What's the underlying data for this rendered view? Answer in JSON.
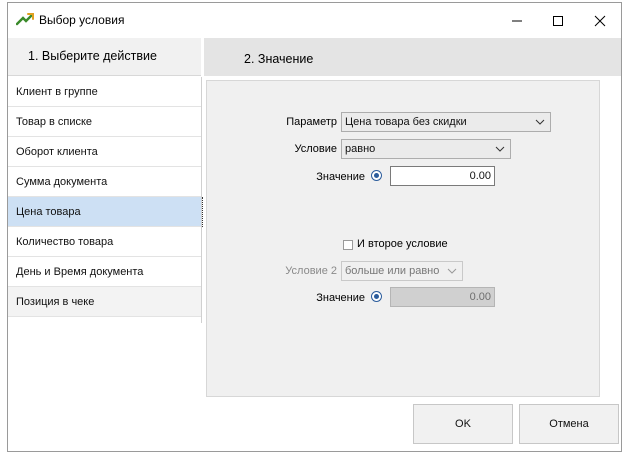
{
  "window": {
    "title": "Выбор условия"
  },
  "left_panel": {
    "header": "1. Выберите  действие",
    "items": [
      {
        "label": "Клиент в группе"
      },
      {
        "label": "Товар в списке"
      },
      {
        "label": "Оборот клиента"
      },
      {
        "label": "Сумма документа"
      },
      {
        "label": "Цена товара",
        "selected": true
      },
      {
        "label": "Количество товара"
      },
      {
        "label": "День и Время документа"
      },
      {
        "label": "Позиция в чеке"
      }
    ]
  },
  "right_panel": {
    "header": "2. Значение",
    "parameter_label": "Параметр",
    "parameter_value": "Цена товара без скидки",
    "condition_label": "Условие",
    "condition_value": "равно",
    "value_label": "Значение",
    "value": "0.00",
    "second_condition_checkbox": "И второе условие",
    "second_condition_checked": false,
    "condition2_label": "Условие 2",
    "condition2_value": "больше или равно",
    "value2_label": "Значение",
    "value2": "0.00"
  },
  "buttons": {
    "ok": "OK",
    "cancel": "Отмена"
  },
  "colors": {
    "selected_item": "#cde0f4",
    "radio": "#2b5c9c",
    "header_bg": "#e4e4e4"
  }
}
